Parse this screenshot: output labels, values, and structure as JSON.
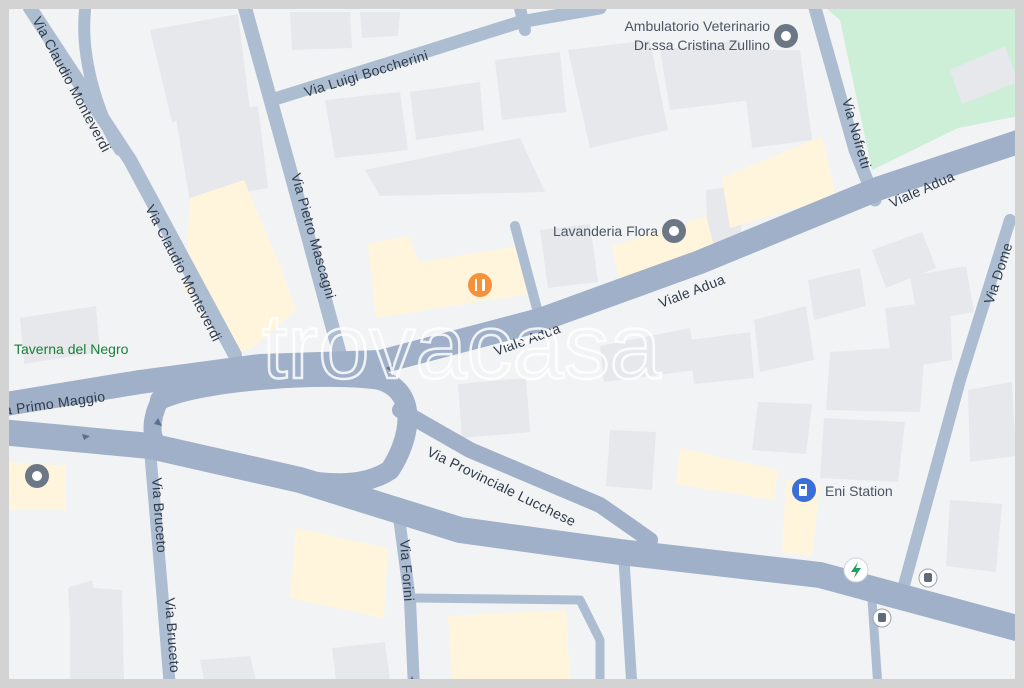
{
  "streets": {
    "boccherini": "Via Luigi Boccherini",
    "monteverdi_top": "Via Claudio Monteverdi",
    "monteverdi": "Via Claudio Monteverdi",
    "mascagni": "Via Pietro Mascagni",
    "nofretti": "Via Nofretti",
    "adua_1": "Viale Adua",
    "adua_2": "Viale Adua",
    "adua_3": "Viale Adua",
    "primo_maggio": "Via Primo Maggio",
    "provinciale": "Via Provinciale Lucchese",
    "brucceto_1": "Via Bruceto",
    "brucceto_2": "Via Bruceto",
    "forini": "Via Forini",
    "domenico": "Via Dome"
  },
  "pois": {
    "vet_line1": "Ambulatorio Veterinario",
    "vet_line2": "Dr.ssa Cristina Zullino",
    "laundry": "Lavanderia Flora",
    "taverna": "Taverna del Negro",
    "eni": "Eni Station"
  },
  "icons": {
    "vet": "pin-icon",
    "laundry": "pin-icon",
    "restaurant": "fork-knife-icon",
    "eni": "fuel-icon",
    "charging": "bolt-icon",
    "bus": "bus-icon"
  },
  "colors": {
    "background": "#f2f3f5",
    "building": "#e6e8ec",
    "building_highlight": "#fff5dc",
    "park": "#cdeed7",
    "major_road": "#9fb0c8",
    "minor_road": "#adbdd1",
    "restaurant_accent": "#f5913a",
    "fuel_accent": "#3b6ed8",
    "charging_accent": "#1e9e5c",
    "pin_accent": "#6b7785"
  },
  "watermark": "trovacasa"
}
